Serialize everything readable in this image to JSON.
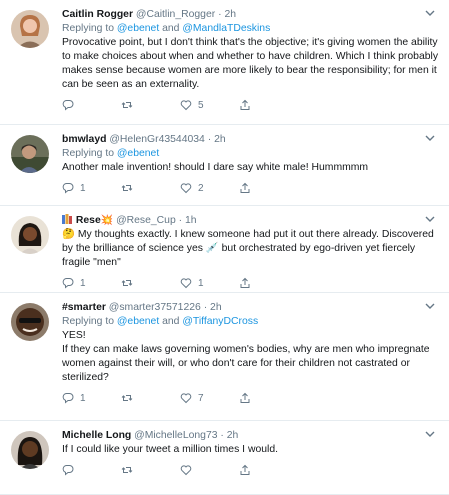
{
  "colors": {
    "link": "#1b95e0",
    "muted": "#657786",
    "text": "#14171a",
    "divider": "#e6ecf0"
  },
  "tweets": [
    {
      "name": "Caitlin Rogger",
      "handle": "@Caitlin_Rogger",
      "time": "2h",
      "replying_label": "Replying to",
      "mention1": "@ebenet",
      "and": "and",
      "mention2": "@MandlaTDeskins",
      "text": "Provocative point, but I don't think that's the objective; it's giving women the ability to make choices about when and whether to have children. Which I think probably makes sense because women are more likely to bear the responsibility; for men it can be seen as an externality.",
      "replies": "",
      "retweets": "",
      "likes": "5"
    },
    {
      "name": "bmwlayd",
      "handle": "@HelenGr43544034",
      "time": "2h",
      "replying_label": "Replying to",
      "mention1": "@ebenet",
      "text": "Another male invention! should I dare say white male! Hummmmm",
      "replies": "1",
      "retweets": "",
      "likes": "2"
    },
    {
      "name": "Rese",
      "flag_icon": "flag-emoji",
      "flag": "💥",
      "handle": "@Rese_Cup",
      "time": "1h",
      "emoji": "🤔",
      "text_a": " My thoughts exactly. I knew someone had put it out there already. Discovered by the brilliance of science yes ",
      "emoji2": "💉",
      "text_b": " but orchestrated by ego-driven yet fiercely fragile \"men\"",
      "replies": "1",
      "retweets": "",
      "likes": "1"
    },
    {
      "name": "#smarter",
      "handle": "@smarter37571226",
      "time": "2h",
      "replying_label": "Replying to",
      "mention1": "@ebenet",
      "and": "and",
      "mention2": "@TiffanyDCross",
      "text": "YES!\nIf they can make laws governing women's bodies, why are men who impregnate women against their will, or who don't care for their children not castrated or sterilized?",
      "replies": "1",
      "retweets": "",
      "likes": "7"
    },
    {
      "name": "Michelle Long",
      "handle": "@MichelleLong73",
      "time": "2h",
      "text": "If I could like your tweet a million times I would.",
      "replies": "",
      "retweets": "",
      "likes": ""
    }
  ]
}
